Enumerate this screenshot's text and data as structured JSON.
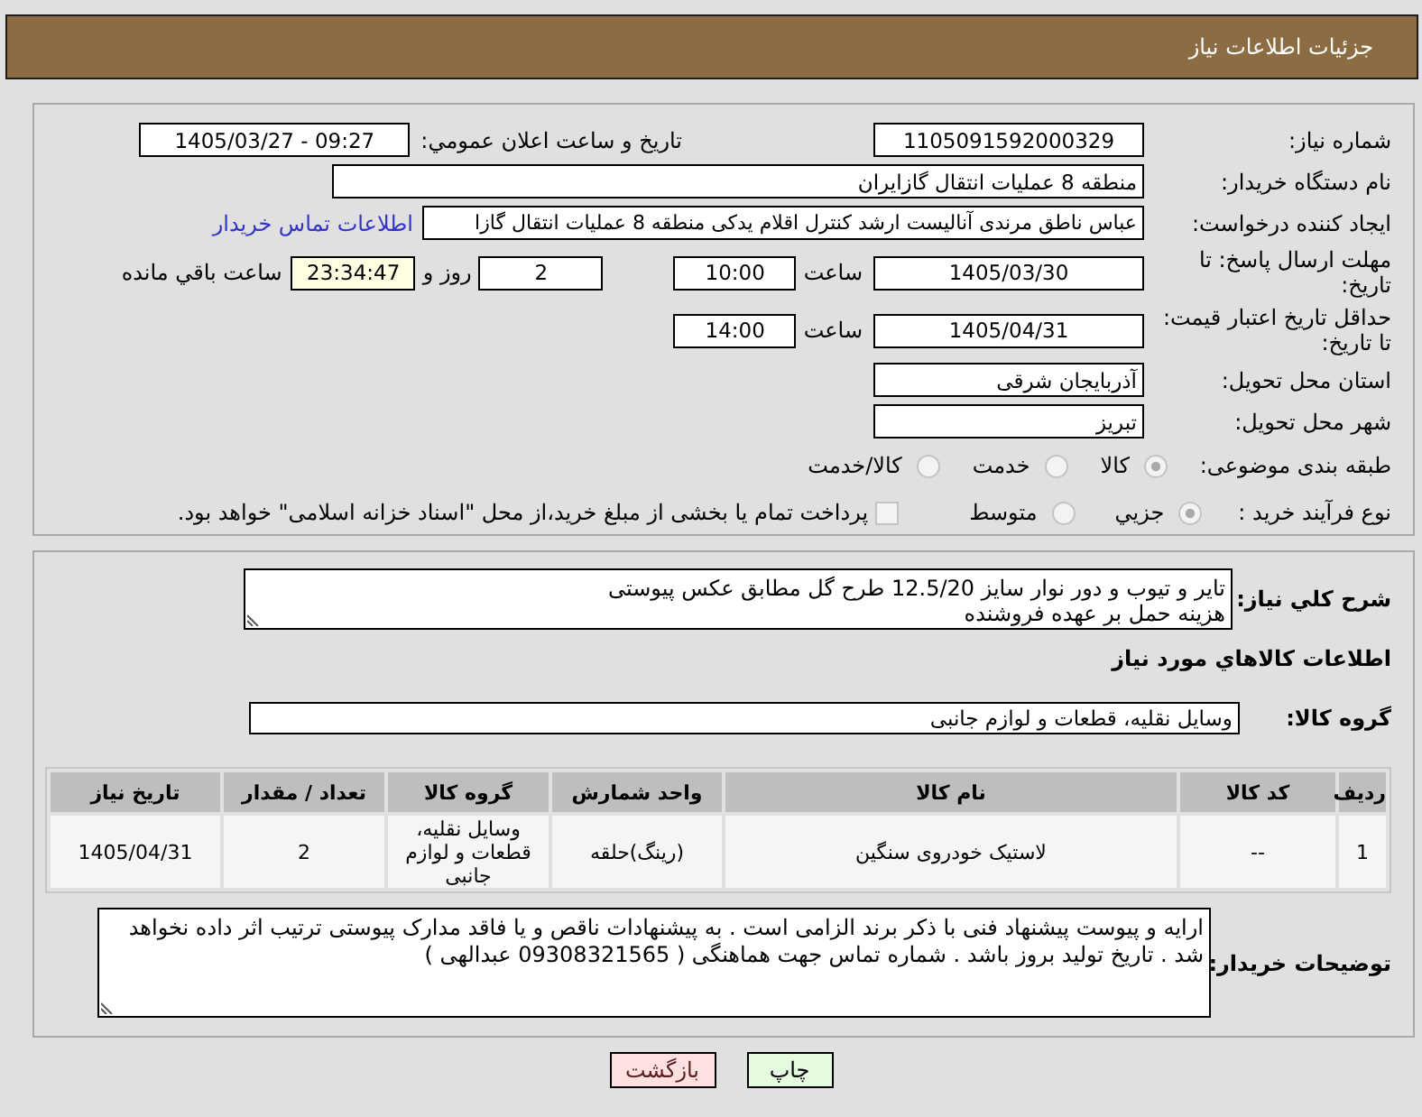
{
  "header": {
    "title": "جزئیات اطلاعات نیاز"
  },
  "details": {
    "need_number": {
      "label": "شماره نیاز:",
      "value": "1105091592000329"
    },
    "announcement": {
      "label": "تاریخ و ساعت اعلان عمومي:",
      "value": "1405/03/27 - 09:27"
    },
    "buyer_org": {
      "label": "نام دستگاه خریدار:",
      "value": "منطقه 8 عملیات انتقال گازایران"
    },
    "requester": {
      "label": "ایجاد کننده درخواست:",
      "value": "عباس ناطق مرندی آنالیست ارشد کنترل اقلام یدکی منطقه 8 عملیات انتقال گازا",
      "contact_link": "اطلاعات تماس خریدار"
    },
    "response_deadline": {
      "label": "مهلت ارسال پاسخ: تا تاریخ:",
      "date": "1405/03/30",
      "time_label": "ساعت",
      "time": "10:00",
      "days": "2",
      "days_label": "روز و",
      "remaining": "23:34:47",
      "remaining_label": "ساعت باقي مانده"
    },
    "price_validity": {
      "label": "حداقل تاریخ اعتبار قیمت: تا تاریخ:",
      "date": "1405/04/31",
      "time_label": "ساعت",
      "time": "14:00"
    },
    "province": {
      "label": "استان محل تحویل:",
      "value": "آذربایجان شرقی"
    },
    "city": {
      "label": "شهر محل تحویل:",
      "value": "تبریز"
    },
    "category": {
      "label": "طبقه بندی موضوعی:",
      "options": [
        {
          "label": "کالا",
          "selected": true
        },
        {
          "label": "خدمت",
          "selected": false
        },
        {
          "label": "کالا/خدمت",
          "selected": false
        }
      ]
    },
    "purchase_process": {
      "label": "نوع فرآیند خرید :",
      "options": [
        {
          "label": "جزیي",
          "selected": true
        },
        {
          "label": "متوسط",
          "selected": false
        }
      ],
      "treasury_payment": {
        "label": "پرداخت تمام یا بخشی از مبلغ خرید،از محل \"اسناد خزانه اسلامی\" خواهد بود.",
        "checked": false
      }
    }
  },
  "need_summary": {
    "label": "شرح کلي نیاز:",
    "value": "تایر و تیوب و دور نوار سایز 12.5/20 طرح گل مطابق عکس پیوستی\nهزینه حمل بر عهده فروشنده"
  },
  "goods": {
    "title": "اطلاعات کالاهاي مورد نیاز",
    "group_label": "گروه کالا:",
    "group_value": "وسایل نقلیه، قطعات و لوازم جانبی",
    "table": {
      "columns": [
        "ردیف",
        "کد کالا",
        "نام کالا",
        "واحد شمارش",
        "گروه کالا",
        "تعداد / مقدار",
        "تاریخ نیاز"
      ],
      "rows": [
        [
          "1",
          "--",
          "لاستیک خودروی سنگین",
          "(رینگ)حلقه",
          "وسایل نقلیه، قطعات و لوازم جانبی",
          "2",
          "1405/04/31"
        ]
      ]
    }
  },
  "buyer_notes": {
    "label": "توضیحات خریدار:",
    "value": "ارایه و پیوست پیشنهاد فنی با ذکر برند الزامی است . به پیشنهادات ناقص و یا فاقد مدارک پیوستی ترتیب اثر داده نخواهد شد . تاریخ تولید بروز باشد . شماره تماس جهت هماهنگی ( 09308321565 عبدالهی )"
  },
  "buttons": [
    {
      "label": "چاپ",
      "kind": "print"
    },
    {
      "label": "بازگشت",
      "kind": "back"
    }
  ]
}
